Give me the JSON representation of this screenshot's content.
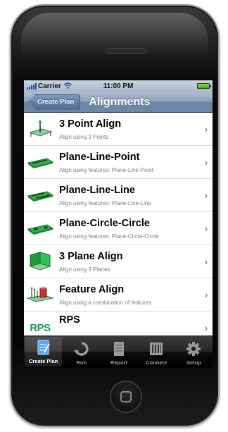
{
  "status_bar": {
    "carrier": "Carrier",
    "time": "11:00 PM"
  },
  "nav": {
    "back_label": "Create Plan",
    "title": "Alignments"
  },
  "alignments": [
    {
      "title": "3 Point Align",
      "subtitle": "Align using 3 Points",
      "icon": "three-point-align-icon"
    },
    {
      "title": "Plane-Line-Point",
      "subtitle": "Align using features: Plane-Line-Point",
      "icon": "plane-line-point-icon"
    },
    {
      "title": "Plane-Line-Line",
      "subtitle": "Align using features: Plane-Line-Line",
      "icon": "plane-line-line-icon"
    },
    {
      "title": "Plane-Circle-Circle",
      "subtitle": "Align using features: Plane-Circle-Circle",
      "icon": "plane-circle-circle-icon"
    },
    {
      "title": "3 Plane Align",
      "subtitle": "Align using 3 Planes",
      "icon": "three-plane-align-icon"
    },
    {
      "title": "Feature Align",
      "subtitle": "Align using a combination of features",
      "icon": "feature-align-icon"
    },
    {
      "title": "RPS",
      "subtitle": "",
      "icon": "rps-logo-icon",
      "logo_text": "RPS"
    }
  ],
  "tabs": [
    {
      "label": "Create Plan",
      "icon": "create-plan-icon",
      "active": true
    },
    {
      "label": "Run",
      "icon": "run-icon",
      "active": false
    },
    {
      "label": "Report",
      "icon": "report-icon",
      "active": false
    },
    {
      "label": "Connect",
      "icon": "connect-icon",
      "active": false
    },
    {
      "label": "Setup",
      "icon": "setup-gear-icon",
      "active": false
    }
  ],
  "colors": {
    "nav_bar": "#6f87a6",
    "plane_green": "#2db34a",
    "rps_green": "#14a24a",
    "tab_active_icon": "#5aa9ff"
  }
}
